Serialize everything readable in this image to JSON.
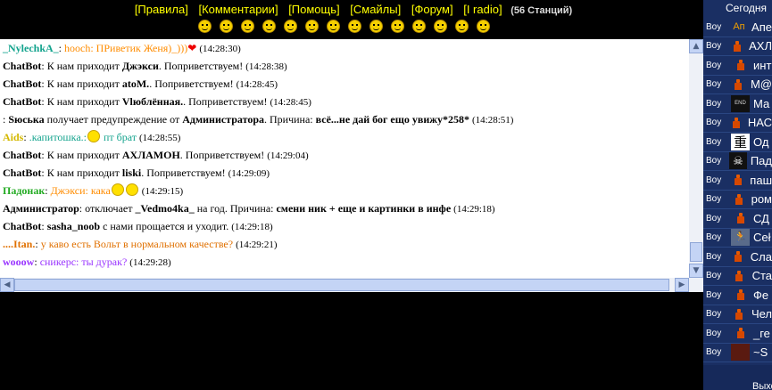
{
  "menu": {
    "items": [
      "[Правила]",
      "[Комментарии]",
      "[Помощь]",
      "[Смайлы]",
      "[Форум]",
      "[I radio]"
    ],
    "stations": "(56 Станций)"
  },
  "smiles": [
    "smile-icon",
    "smile-icon",
    "smile-icon",
    "grin-icon",
    "smile-icon",
    "smile-icon",
    "cool-icon",
    "smile-icon",
    "smile-icon",
    "smile-icon",
    "smile-icon",
    "smile-icon",
    "smile-icon",
    "smile-icon"
  ],
  "chat": [
    {
      "nick": "_NylechkA_",
      "sep": ": ",
      "text": "hooch: ПРиветик Женя)_)))",
      "ts": "(14:28:30)",
      "nickColor": "#13a38d",
      "textColor": "#ff8c00",
      "heart": true
    },
    {
      "nick": "ChatBot",
      "sep": ": ",
      "pre": "К нам приходит ",
      "hl": "Джэкси",
      "post": ". Поприветствуем! ",
      "ts": "(14:28:38)"
    },
    {
      "nick": "ChatBot",
      "sep": ": ",
      "pre": "К нам приходит ",
      "hl": "atoM.",
      "post": ". Поприветствуем! ",
      "ts": "(14:28:45)"
    },
    {
      "nick": "ChatBot",
      "sep": ": ",
      "pre": "К нам приходит ",
      "hl": "Vlюблённая.",
      "post": ". Поприветствуем! ",
      "ts": "(14:28:45)"
    },
    {
      "nick": "",
      "sep": ": ",
      "pre": "",
      "hl": "Sюська",
      "post": " получает предупреждение от ",
      "hl2": "Администратора",
      "post2": ". Причина: ",
      "hl3": "всё...не дай бог ещо увижу*258*",
      "ts": "(14:28:51)"
    },
    {
      "nick": "Aids",
      "sep": ": ",
      "text": ".капитошка.:",
      "text2": " пт брат",
      "ts": "(14:28:55)",
      "nickColor": "#d4b800",
      "textColor": "#13a38d",
      "emo": 1
    },
    {
      "nick": "ChatBot",
      "sep": ": ",
      "pre": "К нам приходит ",
      "hl": "АХЛАМОН",
      "post": ". Поприветствуем! ",
      "ts": "(14:29:04)"
    },
    {
      "nick": "ChatBot",
      "sep": ": ",
      "pre": "К нам приходит ",
      "hl": "liski",
      "post": ". Поприветствуем! ",
      "ts": "(14:29:09)"
    },
    {
      "nick": "Падонак",
      "sep": ": ",
      "text": "Джэкси: кака",
      "ts": "(14:29:15)",
      "nickColor": "#22aa22",
      "textColor": "#ff8c00",
      "emo": 2
    },
    {
      "nick": "Администратор",
      "sep": ": ",
      "pre": "отключает ",
      "hl": "_Vedmo4ka_",
      "post": " на год. Причина: ",
      "hl3": "смени ник + еще и картинки в инфе",
      "ts": "(14:29:18)"
    },
    {
      "nick": "ChatBot",
      "sep": ": ",
      "pre": "",
      "hl": "sasha_noob",
      "post": " с нами прощается и уходит. ",
      "ts": "(14:29:18)"
    },
    {
      "nick": "....Itan.",
      "sep": ": ",
      "text": "у каво есть Вольт в нормальном качестве?",
      "ts": "(14:29:21)",
      "nickColor": "#e07000",
      "textColor": "#e07000"
    },
    {
      "nick": "wooow",
      "sep": ": ",
      "text": "сникерс: ты дурак?",
      "ts": "(14:29:28)",
      "nickColor": "#9933ff",
      "textColor": "#9933ff"
    }
  ],
  "users": {
    "header": "Сегодня",
    "footer": "Выход",
    "list": [
      {
        "gender": "Boy",
        "name": "Апе",
        "avatar": "ap-logo"
      },
      {
        "gender": "Boy",
        "name": "АХЛ",
        "avatar": "person"
      },
      {
        "gender": "Boy",
        "name": "инт",
        "avatar": "person"
      },
      {
        "gender": "Boy",
        "name": "M@",
        "avatar": "person"
      },
      {
        "gender": "Boy",
        "name": "Ма",
        "avatar": "the-end"
      },
      {
        "gender": "Boy",
        "name": "НАС",
        "avatar": "person"
      },
      {
        "gender": "Boy",
        "name": "Од",
        "avatar": "kanji"
      },
      {
        "gender": "Boy",
        "name": "Пад",
        "avatar": "skull"
      },
      {
        "gender": "Boy",
        "name": "паш",
        "avatar": "person"
      },
      {
        "gender": "Boy",
        "name": "ром",
        "avatar": "person"
      },
      {
        "gender": "Boy",
        "name": "СД",
        "avatar": "person"
      },
      {
        "gender": "Boy",
        "name": "Сеł",
        "avatar": "runner"
      },
      {
        "gender": "Boy",
        "name": "Сла",
        "avatar": "person"
      },
      {
        "gender": "Boy",
        "name": "Ста",
        "avatar": "person"
      },
      {
        "gender": "Boy",
        "name": "Фе",
        "avatar": "person"
      },
      {
        "gender": "Boy",
        "name": "Чел",
        "avatar": "person"
      },
      {
        "gender": "Boy",
        "name": "_ге",
        "avatar": "person"
      },
      {
        "gender": "Boy",
        "name": "~S",
        "avatar": "dark"
      }
    ]
  },
  "colors": {
    "accent": "#ffff00",
    "sidebar": "#1a2f63",
    "scrollbar": "#c4d4f5"
  }
}
